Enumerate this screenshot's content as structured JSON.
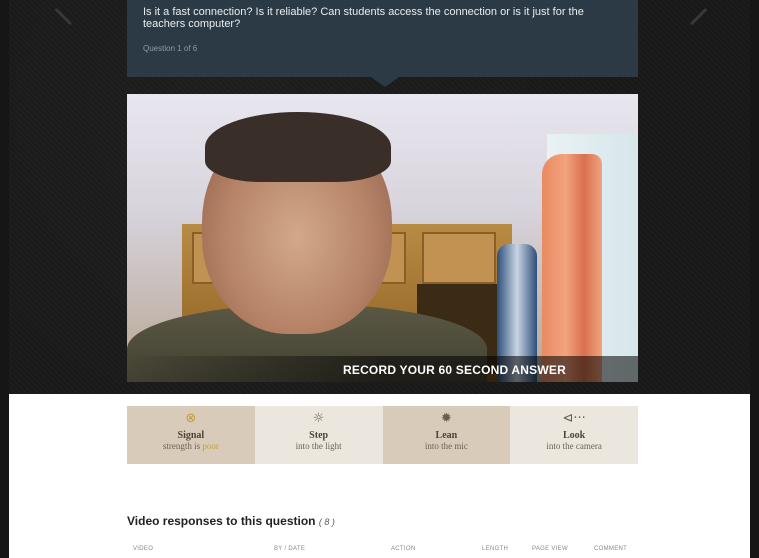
{
  "question": {
    "text": "Is it a fast connection? Is it reliable? Can students access the connection or is it just for the teachers computer?",
    "counter": "Question 1 of 6"
  },
  "video": {
    "record_label": "RECORD YOUR 60 SECOND ANSWER"
  },
  "tips": [
    {
      "icon": "⊗",
      "title": "Signal",
      "sub_prefix": "strength is ",
      "sub_highlight": "poor"
    },
    {
      "icon": "☼",
      "title": "Step",
      "sub": "into the light"
    },
    {
      "icon": "✹",
      "title": "Lean",
      "sub": "into the mic"
    },
    {
      "icon": "⊲···",
      "title": "Look",
      "sub": "into the camera"
    }
  ],
  "responses": {
    "heading": "Video responses to this question",
    "count": "( 8 )",
    "columns": [
      "VIDEO",
      "BY / DATE",
      "ACTION",
      "LENGTH",
      "PAGE VIEW",
      "COMMENT"
    ]
  },
  "colors": {
    "question_bg": "#2c3a45",
    "tip_shade": "#d8cbb9",
    "tip_light": "#ece7de",
    "warning": "#c69a33"
  }
}
